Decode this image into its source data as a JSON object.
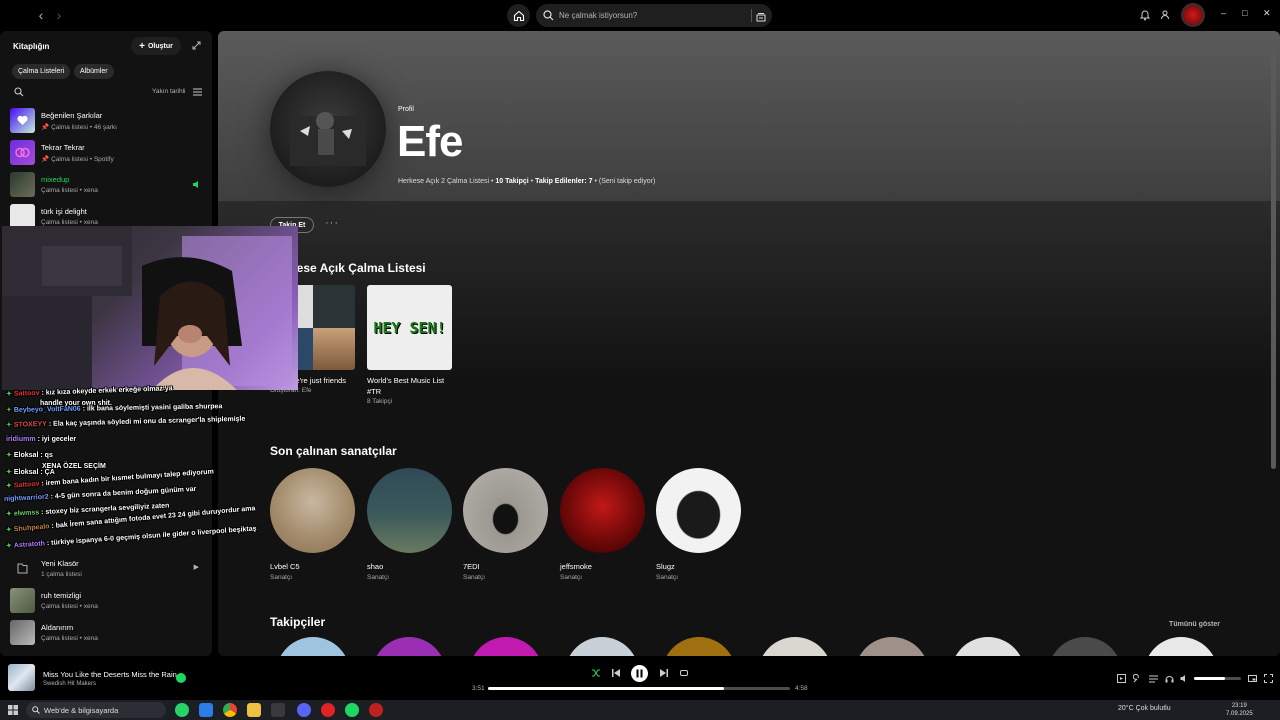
{
  "topbar": {
    "search_placeholder": "Ne çalmak istiyorsun?",
    "win_minimize": "–",
    "win_maximize": "□",
    "win_close": "✕"
  },
  "sidebar": {
    "title": "Kitaplığın",
    "create_label": "Oluştur",
    "chips": [
      "Çalma Listeleri",
      "Albümler"
    ],
    "sort_label": "Yakın tarihli",
    "items": [
      {
        "name": "Beğenilen Şarkılar",
        "sub": "Çalma listesi • 46 şarkı",
        "pinned": true
      },
      {
        "name": "Tekrar Tekrar",
        "sub": "Çalma listesi • Spotify",
        "pinned": true
      },
      {
        "name": "mixedup",
        "sub": "Çalma listesi • xena",
        "pinned": false,
        "playing": true
      },
      {
        "name": "türk işi delight",
        "sub": "Çalma listesi • xena",
        "pinned": false
      },
      {
        "name": "Yeni Klasör",
        "sub": "1 çalma listesi",
        "pinned": false
      },
      {
        "name": "ruh temizligi",
        "sub": "Çalma listesi • xena",
        "pinned": false
      },
      {
        "name": "Aldanırım",
        "sub": "Çalma listesi • xena",
        "pinned": false
      }
    ]
  },
  "chat": [
    {
      "user": "Sattoov",
      "color": "#e03030",
      "msg": "kız kıza okeyde erkek erkeğe olmaz ya"
    },
    {
      "user": "",
      "color": "#ffffff",
      "msg": "handle your own shit."
    },
    {
      "user": "Beybeyo_VoltFaN06",
      "color": "#6ea0ff",
      "msg": "ilk bana söylemişti yasini galiba shurpea"
    },
    {
      "user": "STOXEYY",
      "color": "#e04848",
      "msg": "Ela kaç yaşında söyledi mi onu da scranger'la shiplemişle"
    },
    {
      "user": "iridiumm",
      "color": "#b07bff",
      "msg": "iyi geceler"
    },
    {
      "user": "Eloksal",
      "color": "#ffffff",
      "msg": "qs"
    },
    {
      "user": "Eloksal",
      "color": "#ffffff",
      "msg": "ÇA"
    },
    {
      "user": "Sattoov",
      "color": "#e03030",
      "msg": "irem bana kadın bir kısmet bulmayı talep ediyorum"
    },
    {
      "user": "nightwarrior2",
      "color": "#7a9cff",
      "msg": "4-5 gün sonra da benim doğum günüm var"
    },
    {
      "user": "elwmss",
      "color": "#6ecf6e",
      "msg": "stoxey biz scrangerla sevgiliyiz zaten"
    },
    {
      "user": "Shuhpealo",
      "color": "#c08040",
      "msg": "bak İrem sana attığım fotoda evet 23 24 gibi duruyordur ama"
    },
    {
      "user": "Astratoth",
      "color": "#b07bff",
      "msg": "türkiye ispanya 6-0 geçmiş olsun ile gider o liverpool beşiktaş"
    }
  ],
  "overlay_texts": {
    "special": "XENA ÖZEL SEÇİM"
  },
  "profile": {
    "label": "Profil",
    "name": "Efe",
    "stats_prefix": "Herkese Açık 2 Çalma Listesi •",
    "followers": "10 Takipçi",
    "following": "Takip Edilenler: 7",
    "follows_you": "• (Seni takip ediyor)",
    "follow_button": "Takip Et",
    "more": "···"
  },
  "sections": {
    "playlists_title": "Herkese Açık Çalma Listesi",
    "artists_title": "Son çalınan sanatçılar",
    "followers_title": "Takipçiler",
    "show_all": "Tümünü göster"
  },
  "playlists": [
    {
      "title": "I said we're just friends",
      "sub": "Oluşturan: Efe"
    },
    {
      "title": "World's Best Music List #TR",
      "sub": "8 Takipçi",
      "cover_text": "HEY SEN!"
    }
  ],
  "artists": [
    {
      "name": "Lvbel C5",
      "sub": "Sanatçı"
    },
    {
      "name": "shao",
      "sub": "Sanatçı"
    },
    {
      "name": "7EDI",
      "sub": "Sanatçı"
    },
    {
      "name": "jeffsmoke",
      "sub": "Sanatçı"
    },
    {
      "name": "Slugz",
      "sub": "Sanatçı"
    }
  ],
  "player": {
    "title": "Miss You Like the Deserts Miss the Rain",
    "artist": "Swedish Hit Makers",
    "elapsed": "3:51",
    "duration": "4:58",
    "progress_fraction": 0.78,
    "volume_fraction": 0.65
  },
  "taskbar": {
    "search_text": "Web'de & bilgisayarda",
    "weather": "20°C  Çok bulutlu",
    "time": "23:19",
    "date": "7.09.2025"
  },
  "colors": {
    "spotify_green": "#1ed760",
    "main_bg": "#121212"
  }
}
